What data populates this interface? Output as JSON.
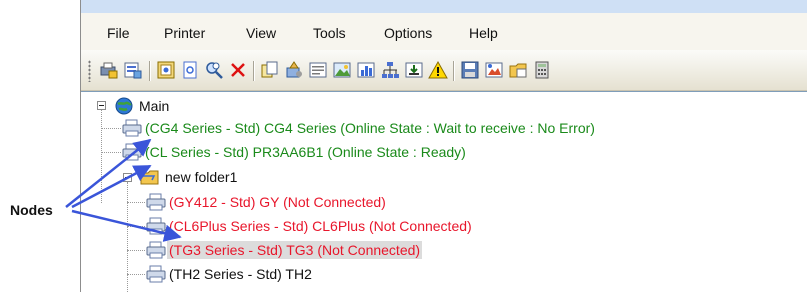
{
  "menu": {
    "items": [
      "File",
      "Printer",
      "View",
      "Tools",
      "Options",
      "Help"
    ]
  },
  "toolbar": {
    "icons": [
      "connect-printer-icon",
      "printer-list-icon",
      "properties-icon",
      "document-icon",
      "search-printers-icon",
      "delete-icon",
      "copy-icon",
      "tools-icon",
      "form-icon",
      "image-icon",
      "chart-icon",
      "network-icon",
      "export-icon",
      "warning-icon",
      "save-icon",
      "picture-icon",
      "folder-icon",
      "calculator-icon"
    ]
  },
  "tree": {
    "root": {
      "label": "Main",
      "icon": "globe-icon"
    },
    "nodes": [
      {
        "label": "(CG4 Series - Std) CG4 Series (Online State : Wait to receive : No Error)",
        "color": "#1a8a1a"
      },
      {
        "label": "(CL Series - Std) PR3AA6B1 (Online State : Ready)",
        "color": "#1a8a1a"
      }
    ],
    "folder": {
      "label": "new folder1",
      "icon": "folder-icon"
    },
    "folder_nodes": [
      {
        "label": "(GY412 - Std) GY (Not Connected)",
        "color": "#e8162b"
      },
      {
        "label": "(CL6Plus Series - Std) CL6Plus (Not Connected)",
        "color": "#e8162b"
      },
      {
        "label": "(TG3 Series - Std) TG3 (Not Connected)",
        "color": "#e8162b",
        "selected": true
      },
      {
        "label": "(TH2 Series - Std) TH2",
        "color": "#111111"
      }
    ]
  },
  "callout": {
    "label": "Nodes",
    "color": "#3a55d9"
  }
}
